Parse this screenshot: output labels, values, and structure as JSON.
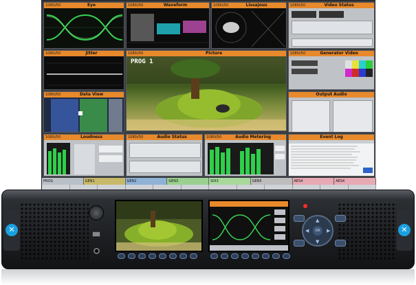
{
  "panels": {
    "eye": {
      "title": "Eye",
      "tc": "1080i/50"
    },
    "waveform": {
      "title": "Waveform",
      "tc": "1080i/50"
    },
    "lissajous": {
      "title": "Lissajous",
      "tc": "1080i/50"
    },
    "video_status": {
      "title": "Video Status",
      "tc": "1080i/50"
    },
    "jitter": {
      "title": "Jitter",
      "tc": "1080i/50"
    },
    "picture": {
      "title": "Picture",
      "tc": "1080i/50",
      "overlay": "PROG 1"
    },
    "generator_video": {
      "title": "Generator Video",
      "tc": "1080i/50"
    },
    "data_view": {
      "title": "Data View",
      "tc": "1080i/50"
    },
    "output_audio": {
      "title": "Output Audio",
      "tc": ""
    },
    "loudness": {
      "title": "Loudness",
      "tc": "1080i/50"
    },
    "audio_status": {
      "title": "Audio Status",
      "tc": "1080i/50"
    },
    "audio_metering": {
      "title": "Audio Metering",
      "tc": "1080i/50"
    },
    "event_log": {
      "title": "Event Log",
      "tc": ""
    }
  },
  "inputs": [
    "PROG",
    "GEN1",
    "GEN2",
    "GEN3",
    "SDI3",
    "GEN5",
    "AES4",
    "AES4"
  ],
  "input_colors": [
    "#b9c0c7",
    "#c8b96a",
    "#8fb2d6",
    "#9ad08f",
    "#a8d99a",
    "#bdbdbd",
    "#e7a9b3",
    "#e7a9b3"
  ],
  "colors": {
    "title_bar": "#e8892b",
    "eye_trace": "#39d353",
    "vectors": "#1fb5c9"
  },
  "icons": [
    "knob-icon",
    "usb-port-icon",
    "headphone-jack-icon",
    "power-led-icon",
    "dpad-icon",
    "brand-logo-icon"
  ]
}
